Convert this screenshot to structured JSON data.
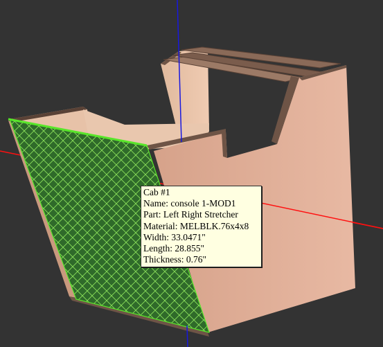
{
  "tooltip": {
    "line1": "Cab #1",
    "line2": "Name: console 1-MOD1",
    "line3": "Part: Left Right Stretcher",
    "line4": "Material: MELBLK.76x4x8",
    "line5": "Width: 33.0471\"",
    "line6": "Length: 28.855\"",
    "line7": "Thickness: 0.76\""
  },
  "colors": {
    "background": "#333333",
    "wood": "#e4b39c",
    "panel_edge": "#6e5446",
    "selection_fill": "#2e6b2a",
    "selection_hatch": "#7edb4a",
    "axis_x": "#ff1010",
    "axis_z": "#1818e0",
    "tooltip_bg": "#ffffe1"
  }
}
